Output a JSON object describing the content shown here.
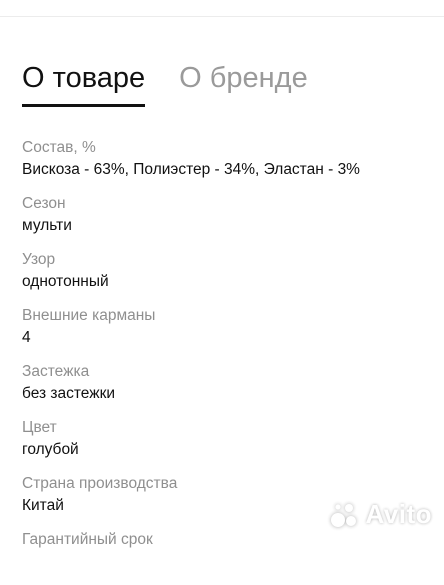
{
  "tabs": [
    {
      "label": "О товаре",
      "active": true
    },
    {
      "label": "О бренде",
      "active": false
    }
  ],
  "specs": [
    {
      "label": "Состав, %",
      "value": "Вискоза - 63%, Полиэстер - 34%, Эластан - 3%"
    },
    {
      "label": "Сезон",
      "value": "мульти"
    },
    {
      "label": "Узор",
      "value": "однотонный"
    },
    {
      "label": "Внешние карманы",
      "value": "4"
    },
    {
      "label": "Застежка",
      "value": "без застежки"
    },
    {
      "label": "Цвет",
      "value": "голубой"
    },
    {
      "label": "Страна производства",
      "value": "Китай"
    },
    {
      "label": "Гарантийный срок",
      "value": ""
    }
  ],
  "watermark": {
    "text": "Avito"
  },
  "colors": {
    "active_tab": "#111111",
    "inactive_tab": "#9a9a9a",
    "label": "#8f8f8f"
  }
}
